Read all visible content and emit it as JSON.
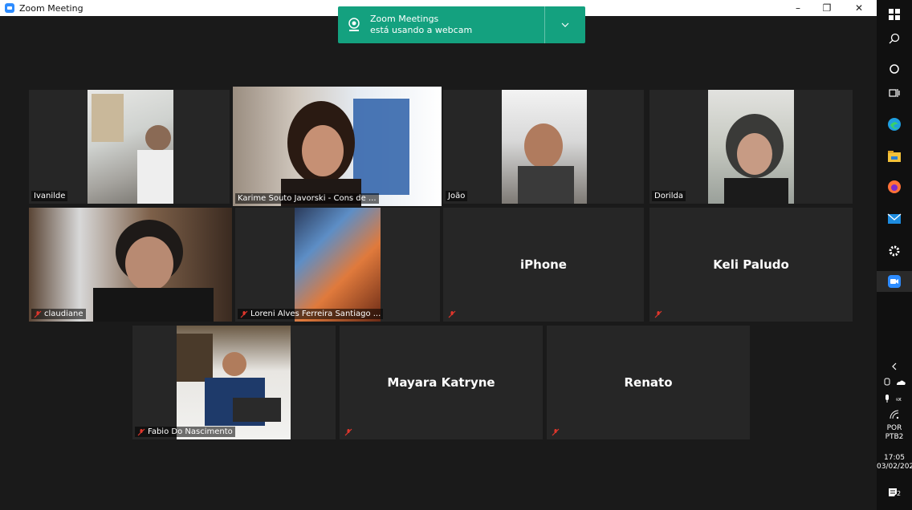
{
  "window": {
    "title": "Zoom Meeting",
    "minimize": "–",
    "restore": "❐",
    "close": "✕"
  },
  "toast": {
    "line1": "Zoom Meetings",
    "line2": "está usando a webcam"
  },
  "participants": [
    {
      "name": "Ivanilde",
      "video": true,
      "muted": false
    },
    {
      "name": "Karime Souto Javorski - Cons de ...",
      "video": true,
      "muted": false,
      "active": true
    },
    {
      "name": "João",
      "video": true,
      "muted": false
    },
    {
      "name": "Dorilda",
      "video": true,
      "muted": false
    },
    {
      "name": "claudiane",
      "video": true,
      "muted": true
    },
    {
      "name": "Loreni Alves Ferreira Santiago ...",
      "video": true,
      "muted": true
    },
    {
      "name": "iPhone",
      "video": false,
      "muted": true
    },
    {
      "name": "Keli Paludo",
      "video": false,
      "muted": true
    },
    {
      "name": "Fabio Do Nascimento",
      "video": true,
      "muted": true
    },
    {
      "name": "Mayara Katryne",
      "video": false,
      "muted": true
    },
    {
      "name": "Renato",
      "video": false,
      "muted": true
    }
  ],
  "taskbar": {
    "icons": [
      "start-icon",
      "search-icon",
      "cortana-icon",
      "task-view-icon",
      "edge-icon",
      "file-explorer-icon",
      "firefox-icon",
      "mail-icon",
      "settings-icon",
      "zoom-icon"
    ],
    "tray_language_1": "POR",
    "tray_language_2": "PTB2",
    "time": "17:05",
    "date": "03/02/202",
    "notification_count": "2"
  }
}
